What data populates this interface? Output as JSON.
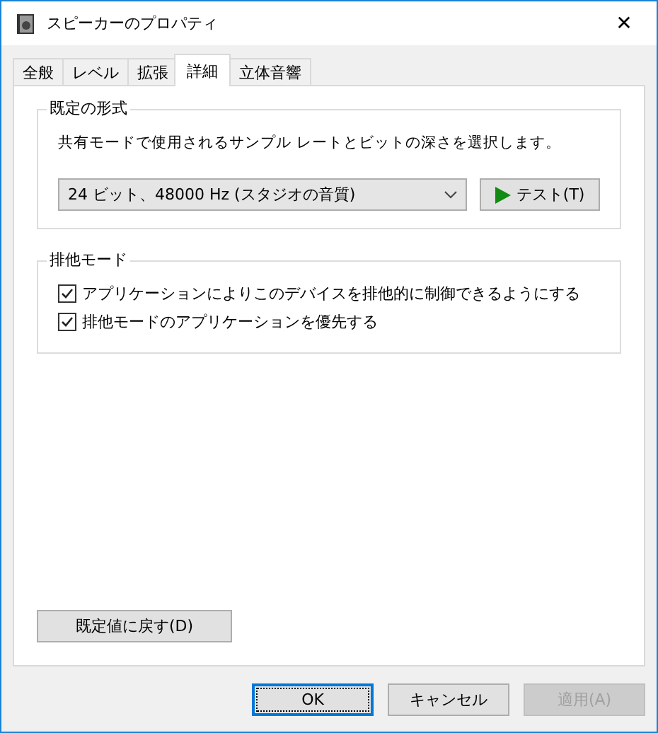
{
  "window": {
    "title": "スピーカーのプロパティ",
    "close": "✕"
  },
  "tabs": [
    {
      "label": "全般",
      "selected": false
    },
    {
      "label": "レベル",
      "selected": false
    },
    {
      "label": "拡張",
      "selected": false
    },
    {
      "label": "詳細",
      "selected": true
    },
    {
      "label": "立体音響",
      "selected": false
    }
  ],
  "format_group": {
    "title": "既定の形式",
    "description": "共有モードで使用されるサンプル レートとビットの深さを選択します。",
    "format": {
      "value": "24 ビット、48000 Hz (スタジオの音質)"
    },
    "test_button": "テスト(T)"
  },
  "exclusive_group": {
    "title": "排他モード",
    "options": [
      {
        "label": "アプリケーションによりこのデバイスを排他的に制御できるようにする",
        "checked": true
      },
      {
        "label": "排他モードのアプリケーションを優先する",
        "checked": true
      }
    ]
  },
  "restore_button": "既定値に戻す(D)",
  "buttons": [
    {
      "label": "OK",
      "kind": "default",
      "disabled": false
    },
    {
      "label": "キャンセル",
      "kind": "normal",
      "disabled": false
    },
    {
      "label": "適用(A)",
      "kind": "normal",
      "disabled": true
    }
  ]
}
